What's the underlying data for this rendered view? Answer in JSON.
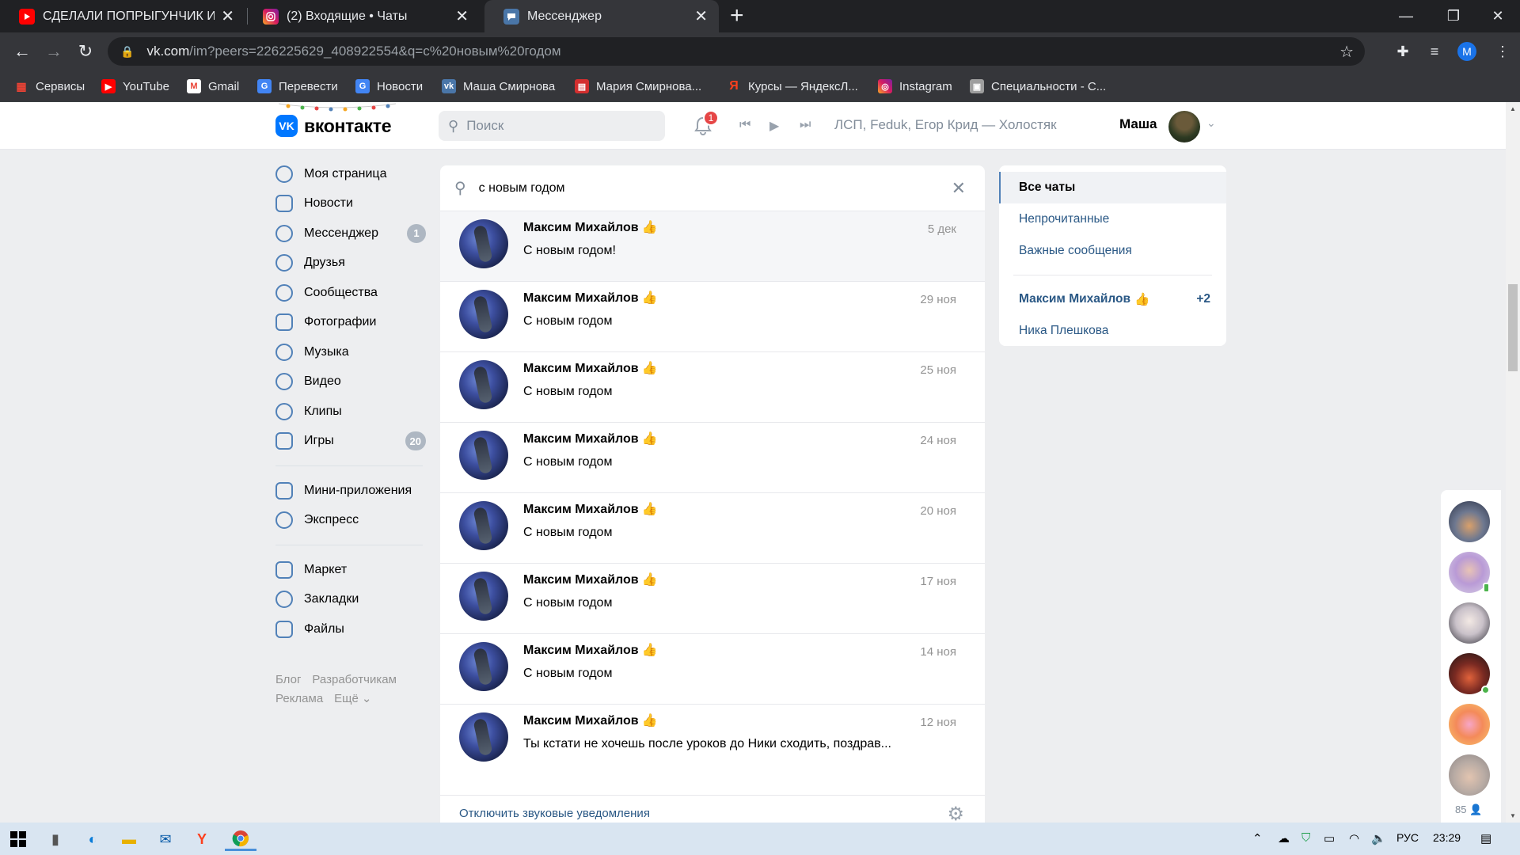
{
  "browser": {
    "tabs": [
      {
        "title": "СДЕЛАЛИ ПОПРЫГУНЧИК ИЗ З",
        "icon": "youtube-icon"
      },
      {
        "title": "(2) Входящие • Чаты",
        "icon": "instagram-icon"
      },
      {
        "title": "Мессенджер",
        "icon": "vk-messenger-icon"
      }
    ],
    "url_host": "vk.com",
    "url_rest": "/im?peers=226225629_408922554&q=c%20новым%20годом",
    "profile_initial": "M",
    "bookmarks": [
      "Сервисы",
      "YouTube",
      "Gmail",
      "Перевести",
      "Новости",
      "Маша Смирнова",
      "Мария Смирнова...",
      "Курсы — ЯндексЛ...",
      "Instagram",
      "Специальности - С..."
    ]
  },
  "header": {
    "logo_text": "вконтакте",
    "search_placeholder": "Поиск",
    "notification_count": "1",
    "now_playing": "ЛСП, Feduk, Егор Крид — Холостяк",
    "user_name": "Маша"
  },
  "sidebar": {
    "items": [
      {
        "label": "Моя страница",
        "icon": "profile-icon",
        "badge": ""
      },
      {
        "label": "Новости",
        "icon": "news-icon",
        "badge": ""
      },
      {
        "label": "Мессенджер",
        "icon": "messenger-icon",
        "badge": "1"
      },
      {
        "label": "Друзья",
        "icon": "friends-icon",
        "badge": ""
      },
      {
        "label": "Сообщества",
        "icon": "communities-icon",
        "badge": ""
      },
      {
        "label": "Фотографии",
        "icon": "photos-icon",
        "badge": ""
      },
      {
        "label": "Музыка",
        "icon": "music-icon",
        "badge": ""
      },
      {
        "label": "Видео",
        "icon": "video-icon",
        "badge": ""
      },
      {
        "label": "Клипы",
        "icon": "clips-icon",
        "badge": ""
      },
      {
        "label": "Игры",
        "icon": "games-icon",
        "badge": "20"
      }
    ],
    "items2": [
      {
        "label": "Мини-приложения",
        "icon": "mini-apps-icon"
      },
      {
        "label": "Экспресс",
        "icon": "express-icon"
      }
    ],
    "items3": [
      {
        "label": "Маркет",
        "icon": "market-icon"
      },
      {
        "label": "Закладки",
        "icon": "bookmarks-icon"
      },
      {
        "label": "Файлы",
        "icon": "files-icon"
      }
    ],
    "footer": [
      "Блог",
      "Разработчикам",
      "Реклама",
      "Ещё"
    ]
  },
  "messenger": {
    "search_value": "с новым годом",
    "dialogs": [
      {
        "name": "Максим Михайлов",
        "date": "5 дек",
        "message": "С новым годом!"
      },
      {
        "name": "Максим Михайлов",
        "date": "29 ноя",
        "message": "С новым годом"
      },
      {
        "name": "Максим Михайлов",
        "date": "25 ноя",
        "message": "С новым годом"
      },
      {
        "name": "Максим Михайлов",
        "date": "24 ноя",
        "message": "С новым годом"
      },
      {
        "name": "Максим Михайлов",
        "date": "20 ноя",
        "message": "С новым годом"
      },
      {
        "name": "Максим Михайлов",
        "date": "17 ноя",
        "message": "С новым годом"
      },
      {
        "name": "Максим Михайлов",
        "date": "14 ноя",
        "message": "С новым годом"
      },
      {
        "name": "Максим Михайлов",
        "date": "12 ноя",
        "message": "Ты кстати не хочешь после уроков до Ники сходить, поздрав..."
      }
    ],
    "footer_link": "Отключить звуковые уведомления"
  },
  "folders": {
    "items": [
      {
        "label": "Все чаты"
      },
      {
        "label": "Непрочитанные"
      },
      {
        "label": "Важные сообщения"
      }
    ],
    "chats": [
      {
        "label": "Максим Михайлов",
        "count": "+2"
      },
      {
        "label": "Ника Плешкова",
        "count": ""
      }
    ]
  },
  "friends_online_count": "85",
  "taskbar": {
    "language": "РУС",
    "time": "23:29"
  },
  "colors": {
    "vk_blue": "#0077ff",
    "link": "#2a5885",
    "accent": "#5181b8",
    "badge_red": "#e64646"
  }
}
